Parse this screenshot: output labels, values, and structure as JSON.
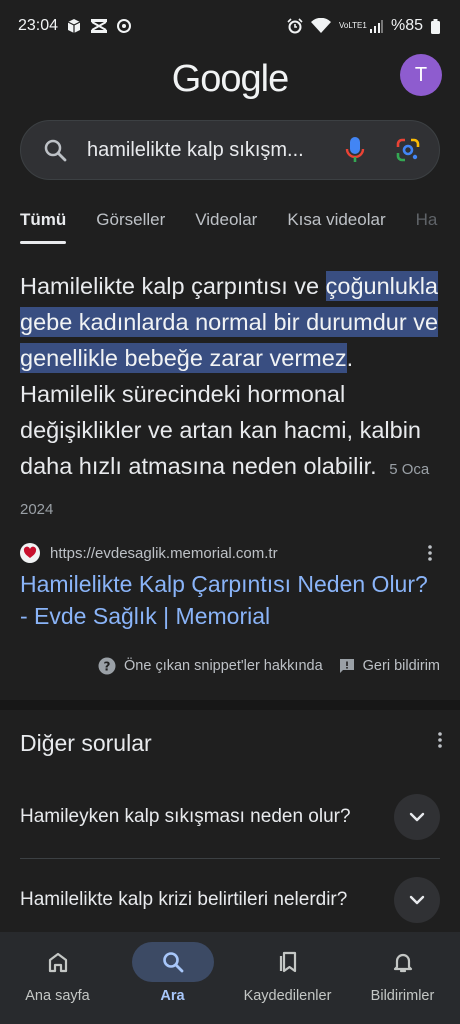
{
  "status_bar": {
    "time": "23:04",
    "battery": "%85",
    "signal_text": "VoLTE1"
  },
  "header": {
    "logo": "Google",
    "avatar_letter": "T"
  },
  "search": {
    "query": "hamilelikte kalp sıkışm..."
  },
  "tabs": [
    {
      "label": "Tümü",
      "active": true
    },
    {
      "label": "Görseller"
    },
    {
      "label": "Videolar"
    },
    {
      "label": "Kısa videolar"
    },
    {
      "label": "Ha"
    }
  ],
  "snippet": {
    "text_before": "Hamilelikte kalp çarpıntısı ve ",
    "highlight": "çoğunlukla gebe kadınlarda normal bir durumdur ve genellikle bebeğe zarar vermez",
    "text_after": ". Hamilelik sürecindeki hormonal değişiklikler ve artan kan hacmi, kalbin daha hızlı atmasına neden olabilir.",
    "date": "5 Oca 2024",
    "source_url": "https://evdesaglik.memorial.com.tr",
    "result_title": "Hamilelikte Kalp Çarpıntısı Neden Olur? - Evde Sağlık | Memorial",
    "about_label": "Öne çıkan snippet'ler hakkında",
    "feedback_label": "Geri bildirim"
  },
  "other_questions": {
    "title": "Diğer sorular",
    "items": [
      "Hamileyken kalp sıkışması neden olur?",
      "Hamilelikte kalp krizi belirtileri nelerdir?"
    ]
  },
  "bottom_nav": [
    {
      "label": "Ana sayfa",
      "icon": "home-icon"
    },
    {
      "label": "Ara",
      "icon": "search-icon",
      "active": true
    },
    {
      "label": "Kaydedilenler",
      "icon": "bookmarks-icon"
    },
    {
      "label": "Bildirimler",
      "icon": "bell-icon"
    }
  ],
  "colors": {
    "background": "#1f1f1f",
    "highlight": "#394e81",
    "link": "#8ab4f8",
    "avatar": "#8e5ccf",
    "nav_active": "#a8c7fa"
  }
}
